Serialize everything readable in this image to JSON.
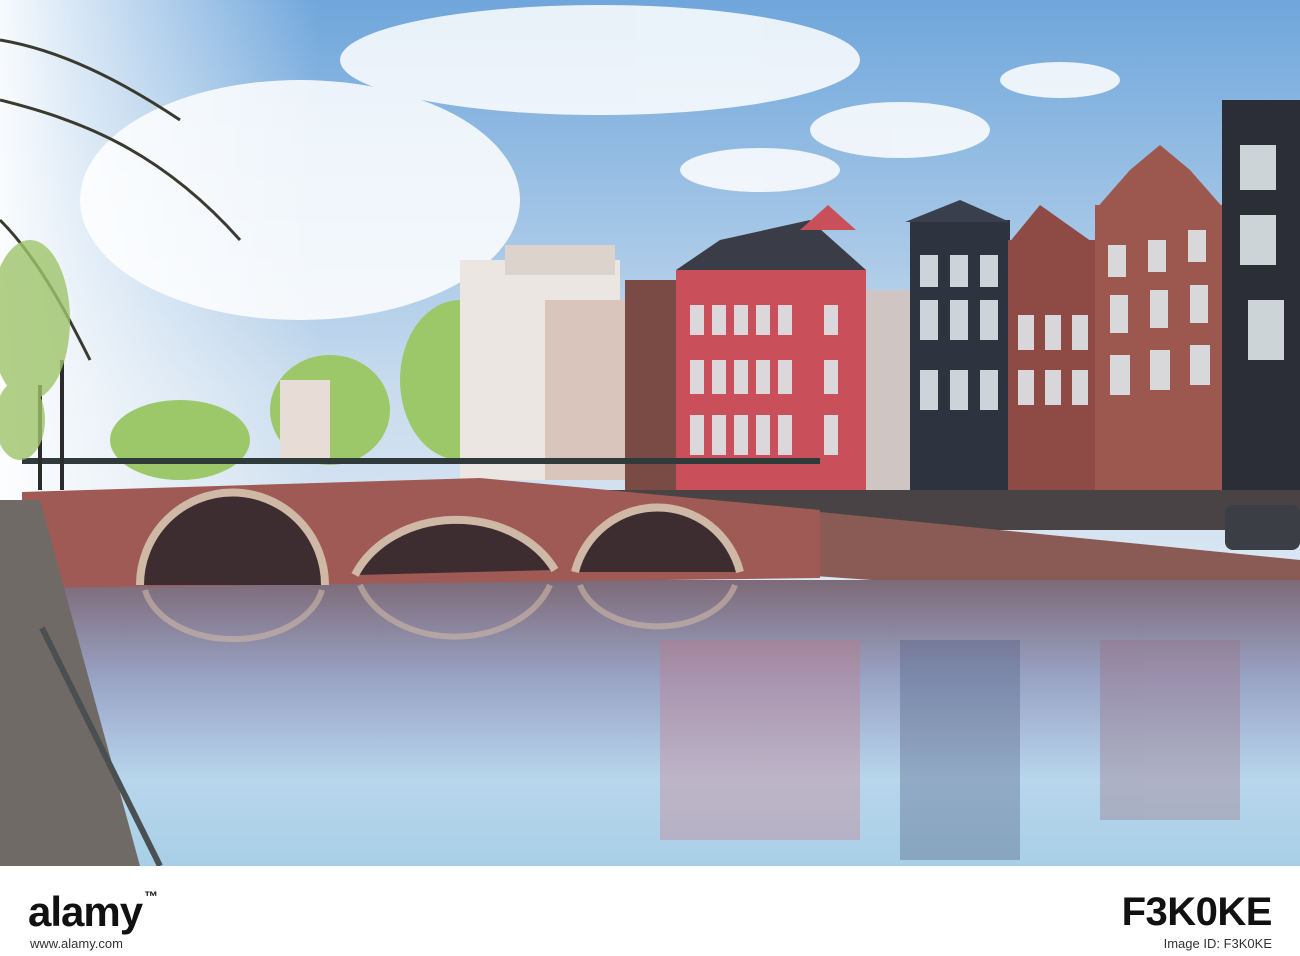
{
  "photo": {
    "subject": "Amsterdam canal houses and arched brick bridge",
    "colors": {
      "sky_top": "#6fa6db",
      "sky_bottom": "#f4f6f8",
      "water_top": "#7d6a78",
      "water_bottom": "#a8cfe6",
      "bridge_brick": "#a05a55",
      "house_red": "#c9505a",
      "house_dark": "#2e3340",
      "tree_green": "#9cc86a"
    }
  },
  "footer": {
    "brand": "alamy",
    "site": "www.alamy.com",
    "image_id": "F3K0KE",
    "image_id_label": "Image ID: F3K0KE"
  }
}
